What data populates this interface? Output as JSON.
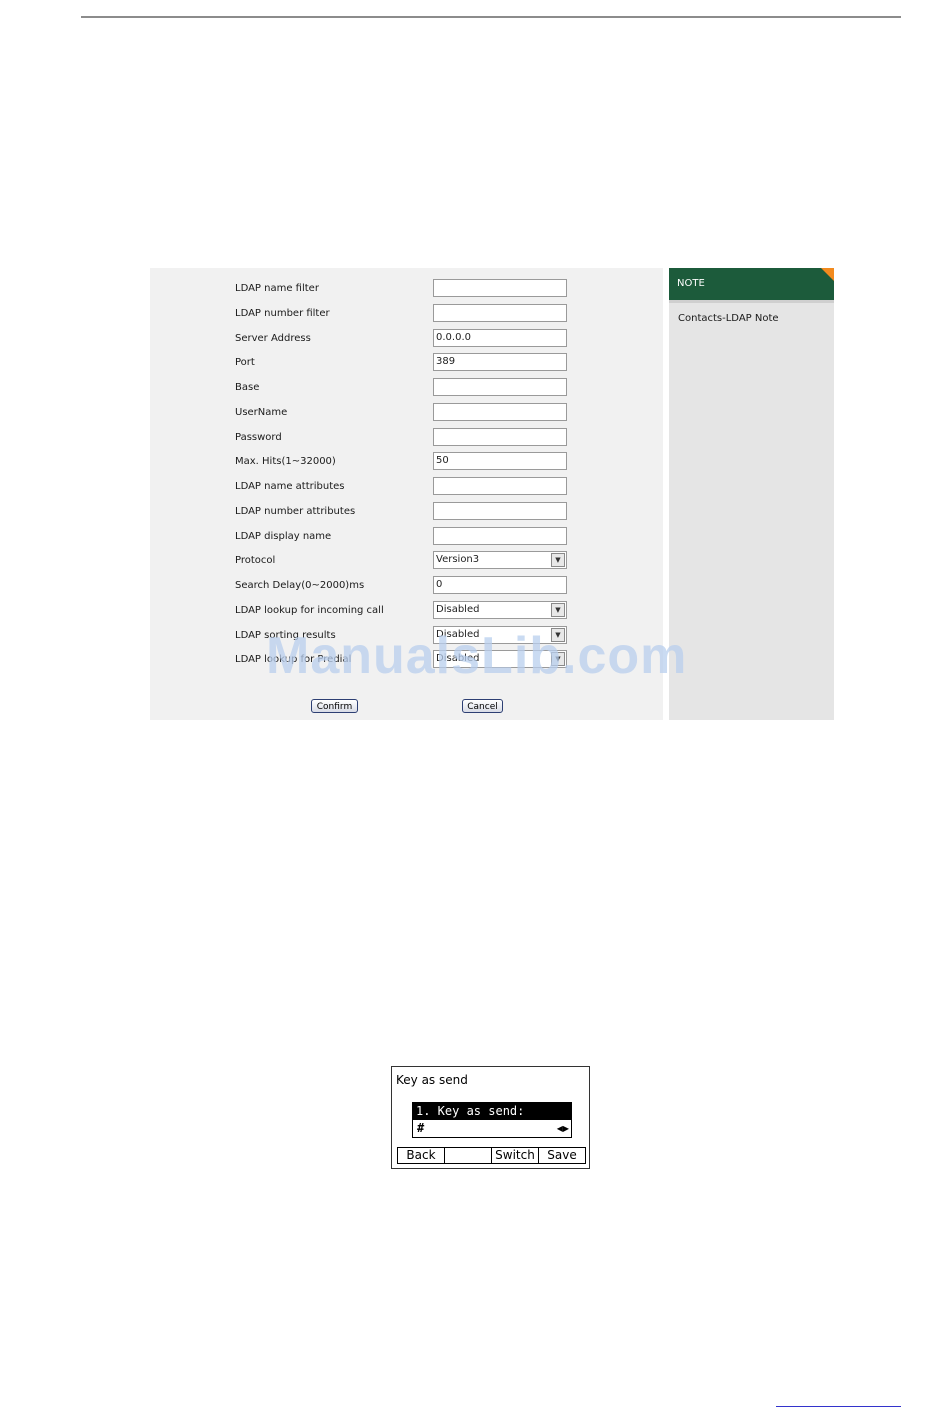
{
  "form": {
    "rows": [
      {
        "label": "LDAP name filter",
        "type": "text",
        "value": ""
      },
      {
        "label": "LDAP number filter",
        "type": "text",
        "value": ""
      },
      {
        "label": "Server Address",
        "type": "text",
        "value": "0.0.0.0"
      },
      {
        "label": "Port",
        "type": "text",
        "value": "389"
      },
      {
        "label": "Base",
        "type": "text",
        "value": ""
      },
      {
        "label": "UserName",
        "type": "text",
        "value": ""
      },
      {
        "label": "Password",
        "type": "text",
        "value": ""
      },
      {
        "label": "Max. Hits(1~32000)",
        "type": "text",
        "value": "50"
      },
      {
        "label": "LDAP name attributes",
        "type": "text",
        "value": ""
      },
      {
        "label": "LDAP number attributes",
        "type": "text",
        "value": ""
      },
      {
        "label": "LDAP display name",
        "type": "text",
        "value": ""
      },
      {
        "label": "Protocol",
        "type": "select",
        "value": "Version3"
      },
      {
        "label": "Search Delay(0~2000)ms",
        "type": "text",
        "value": "0"
      },
      {
        "label": "LDAP lookup for incoming call",
        "type": "select",
        "value": "Disabled"
      },
      {
        "label": "LDAP sorting results",
        "type": "select",
        "value": "Disabled"
      },
      {
        "label": "LDAP lookup for Predial",
        "type": "select",
        "value": "Disabled"
      }
    ],
    "confirm_label": "Confirm",
    "cancel_label": "Cancel"
  },
  "note": {
    "header": "NOTE",
    "text": "Contacts-LDAP Note"
  },
  "watermark": "ManualsLib.com",
  "phone": {
    "title": "Key as send",
    "item_label": "1. Key as send:",
    "item_value": "#",
    "arrows": "◀▶",
    "softkeys": [
      "Back",
      "",
      "Switch",
      "Save"
    ]
  },
  "colors": {
    "note_header": "#1c5b3b",
    "note_corner": "#f28a1e",
    "watermark": "#b9cfee"
  }
}
